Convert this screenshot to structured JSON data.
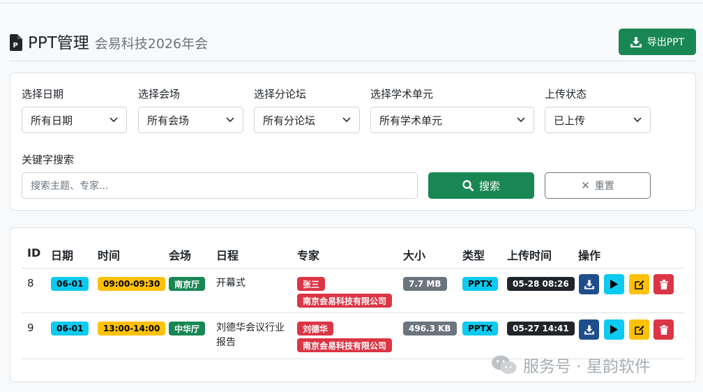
{
  "header": {
    "title": "PPT管理",
    "subtitle": "会易科技2026年会",
    "export_label": "导出PPT"
  },
  "filters": {
    "date": {
      "label": "选择日期",
      "value": "所有日期"
    },
    "venue": {
      "label": "选择会场",
      "value": "所有会场"
    },
    "forum": {
      "label": "选择分论坛",
      "value": "所有分论坛"
    },
    "unit": {
      "label": "选择学术单元",
      "value": "所有学术单元"
    },
    "status": {
      "label": "上传状态",
      "value": "已上传"
    },
    "keyword": {
      "label": "关键字搜索",
      "placeholder": "搜索主题、专家..."
    },
    "search_label": "搜索",
    "reset_label": "重置"
  },
  "table": {
    "headers": [
      "ID",
      "日期",
      "时间",
      "会场",
      "日程",
      "专家",
      "大小",
      "类型",
      "上传时间",
      "操作"
    ],
    "rows": [
      {
        "id": "8",
        "date": "06-01",
        "time": "09:00-09:30",
        "venue": "南京厅",
        "schedule_line1": "开幕式",
        "schedule_line2": "",
        "expert": "张三",
        "org": "南京会易科技有限公司",
        "size": "7.7 MB",
        "type": "PPTX",
        "uploaded": "05-28 08:26"
      },
      {
        "id": "9",
        "date": "06-01",
        "time": "13:00-14:00",
        "venue": "中华厅",
        "schedule_line1": "刘德华会议行业",
        "schedule_line2": "报告",
        "expert": "刘德华",
        "org": "南京会易科技有限公司",
        "size": "496.3 KB",
        "type": "PPTX",
        "uploaded": "05-27 14:41"
      }
    ]
  },
  "watermark": "服务号 · 星韵软件",
  "colors": {
    "primary": "#198754",
    "info": "#0dcaf0",
    "warning": "#ffc107",
    "danger": "#dc3545",
    "download": "#1f4e8c"
  }
}
